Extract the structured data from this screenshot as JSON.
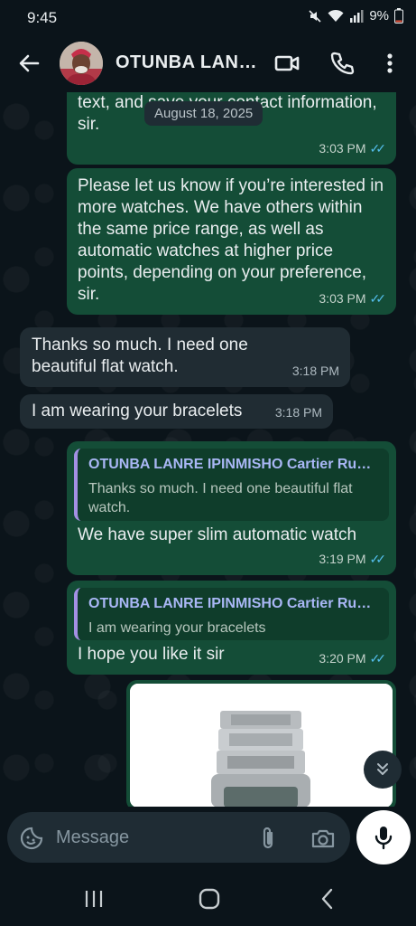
{
  "status": {
    "time": "9:45",
    "battery": "9%"
  },
  "header": {
    "contact_name": "OTUNBA LAN…"
  },
  "chat": {
    "date_pill": "August 18, 2025",
    "messages": [
      {
        "dir": "out",
        "text": "this number. Please feel free to call or text, and save your contact information, sir.",
        "time": "3:03 PM"
      },
      {
        "dir": "out",
        "text": "Please let us know if you’re interested in more watches. We have others within the same price range, as well as automatic watches at higher price points, depending on your preference, sir.",
        "time": "3:03 PM"
      },
      {
        "dir": "in",
        "text": "Thanks so much.  I need one beautiful flat watch.",
        "time": "3:18 PM"
      },
      {
        "dir": "in",
        "text": "I am wearing your bracelets",
        "time": "3:18 PM"
      },
      {
        "dir": "out",
        "quote_name": "OTUNBA LANRE IPINMISHO Cartier Ru…",
        "quote_text": "Thanks so much.  I need one beautiful flat watch.",
        "text": "We have super slim automatic watch",
        "time": "3:19 PM"
      },
      {
        "dir": "out",
        "quote_name": "OTUNBA LANRE IPINMISHO Cartier Ru…",
        "quote_text": "I am wearing your bracelets",
        "text": "I hope you like it sir",
        "time": "3:20 PM"
      }
    ]
  },
  "composer": {
    "placeholder": "Message"
  },
  "colors": {
    "outgoing": "#144d37",
    "incoming": "#202c33",
    "read_ticks": "#53bdeb",
    "background": "#0b141a"
  },
  "icons": [
    "back-arrow-icon",
    "video-call-icon",
    "phone-icon",
    "more-vert-icon",
    "sticker-icon",
    "attach-icon",
    "camera-icon",
    "mic-icon",
    "scroll-down-icon",
    "recents-icon",
    "home-icon",
    "nav-back-icon"
  ]
}
